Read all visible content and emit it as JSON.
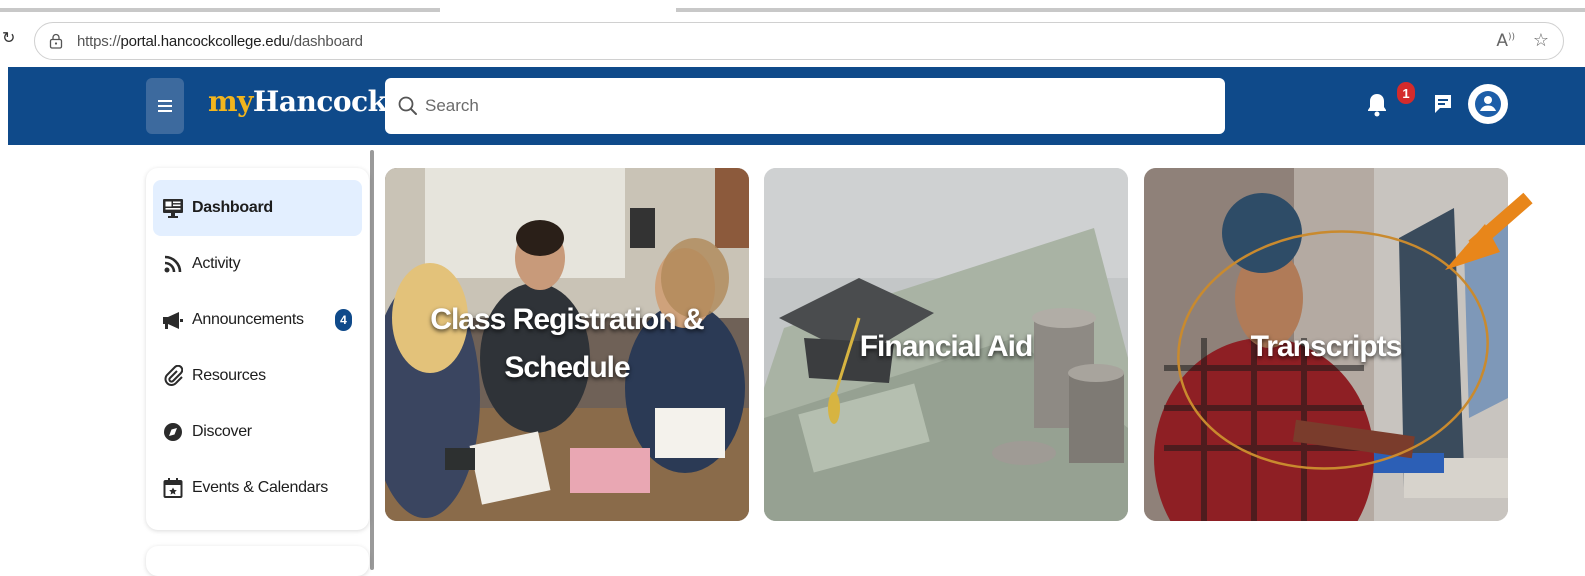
{
  "browser": {
    "url_prefix": "https://",
    "url_host": "portal.hancockcollege.edu",
    "url_path": "/dashboard"
  },
  "header": {
    "logo_my": "my",
    "logo_name": "Hancock",
    "search_placeholder": "Search",
    "notification_count": "1",
    "brand_color": "#0f4a8a",
    "logo_accent_color": "#f2b51d"
  },
  "sidebar": {
    "items": [
      {
        "label": "Dashboard",
        "icon": "dashboard-icon",
        "active": true
      },
      {
        "label": "Activity",
        "icon": "rss-icon"
      },
      {
        "label": "Announcements",
        "icon": "megaphone-icon",
        "badge": "4"
      },
      {
        "label": "Resources",
        "icon": "paperclip-icon"
      },
      {
        "label": "Discover",
        "icon": "compass-icon"
      },
      {
        "label": "Events & Calendars",
        "icon": "calendar-star-icon"
      }
    ]
  },
  "tiles": [
    {
      "label_line1": "Class Registration &",
      "label_line2": "Schedule"
    },
    {
      "label": "Financial Aid"
    },
    {
      "label": "Transcripts"
    }
  ],
  "annotation": {
    "color": "#e8861a"
  }
}
